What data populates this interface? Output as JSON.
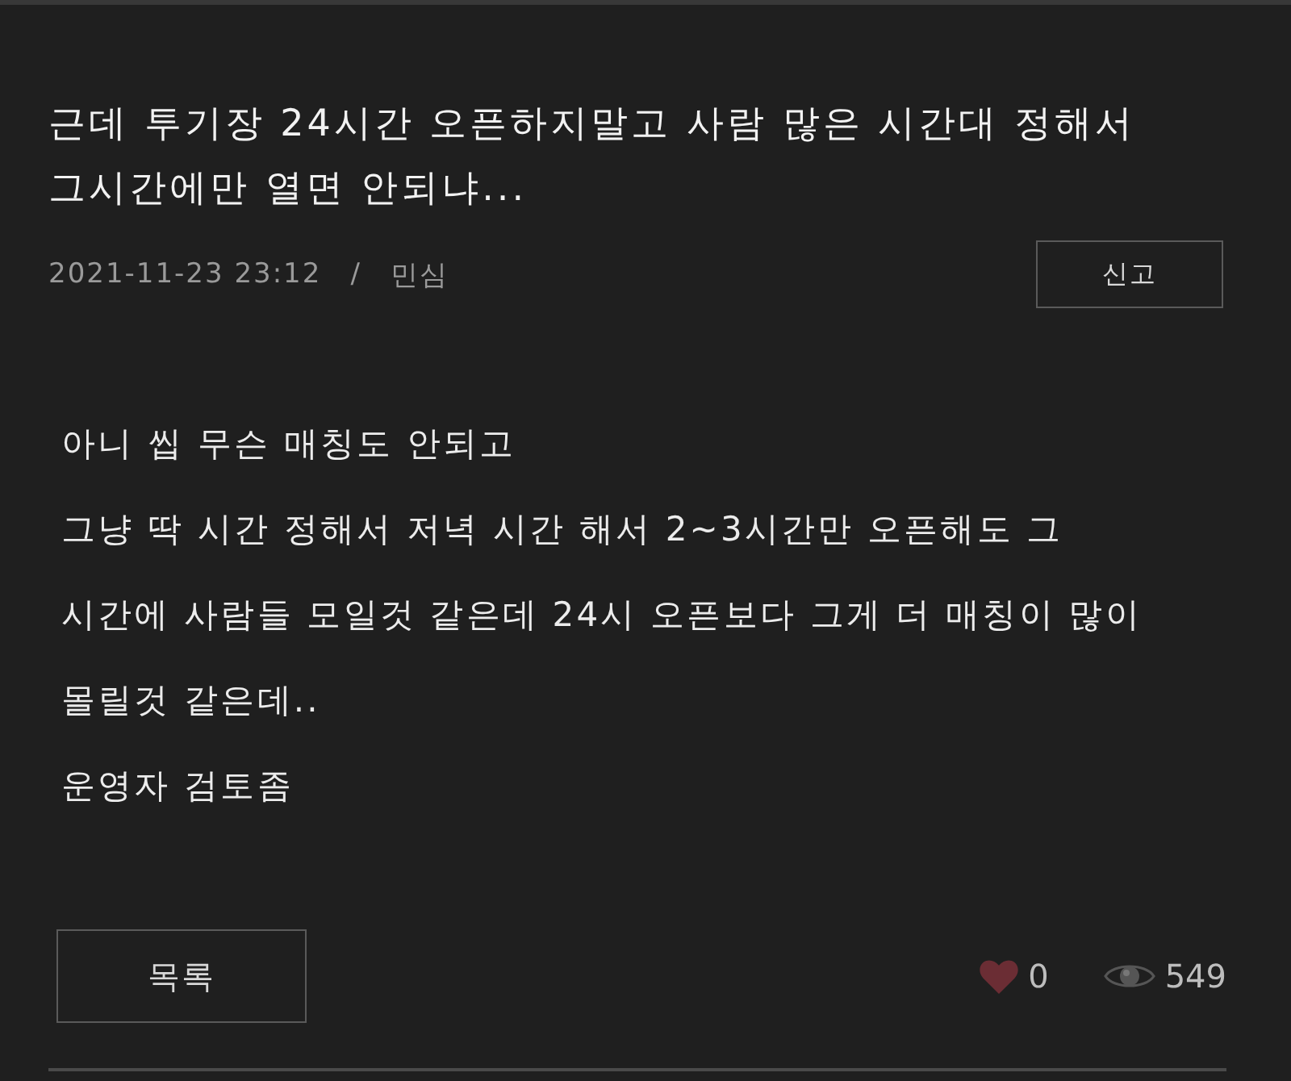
{
  "post": {
    "title_lines": [
      "근데 투기장 24시간 오픈하지말고 사람 많은 시간대 정해서",
      "그시간에만 열면 안되냐..."
    ],
    "date": "2021-11-23 23:12",
    "separator": "/",
    "author": "민심",
    "report_button": "신고"
  },
  "body": {
    "lines": [
      "아니 씹 무슨 매칭도 안되고",
      "그냥 딱 시간 정해서 저녁 시간 해서 2~3시간만 오픈해도 그",
      "시간에 사람들 모일것 같은데 24시 오픈보다 그게 더 매칭이 많이",
      "몰릴것 같은데..",
      "운영자 검토좀"
    ]
  },
  "footer": {
    "list_button": "목록",
    "likes": "0",
    "views": "549"
  }
}
